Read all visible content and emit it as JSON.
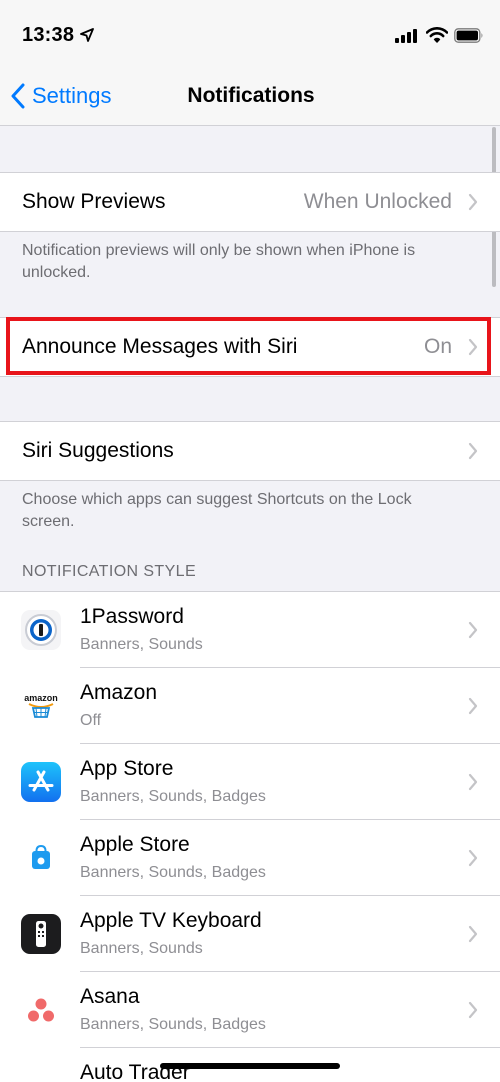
{
  "status_bar": {
    "time": "13:38"
  },
  "nav": {
    "back_label": "Settings",
    "title": "Notifications"
  },
  "show_previews": {
    "label": "Show Previews",
    "value": "When Unlocked",
    "footer": "Notification previews will only be shown when iPhone is unlocked."
  },
  "announce": {
    "label": "Announce Messages with Siri",
    "value": "On"
  },
  "siri_suggestions": {
    "label": "Siri Suggestions",
    "footer": "Choose which apps can suggest Shortcuts on the Lock screen."
  },
  "notification_style": {
    "header": "NOTIFICATION STYLE",
    "apps": [
      {
        "name": "1Password",
        "detail": "Banners, Sounds",
        "icon": "1password-icon"
      },
      {
        "name": "Amazon",
        "detail": "Off",
        "icon": "amazon-icon"
      },
      {
        "name": "App Store",
        "detail": "Banners, Sounds, Badges",
        "icon": "app-store-icon"
      },
      {
        "name": "Apple Store",
        "detail": "Banners, Sounds, Badges",
        "icon": "apple-store-icon"
      },
      {
        "name": "Apple TV Keyboard",
        "detail": "Banners, Sounds",
        "icon": "apple-tv-keyboard-icon"
      },
      {
        "name": "Asana",
        "detail": "Banners, Sounds, Badges",
        "icon": "asana-icon"
      },
      {
        "name": "Auto Trader",
        "detail": "",
        "icon": "auto-trader-icon"
      }
    ]
  },
  "amazon_icon_text": "amazon",
  "colors": {
    "accent": "#007aff",
    "highlight": "#e8141a"
  }
}
